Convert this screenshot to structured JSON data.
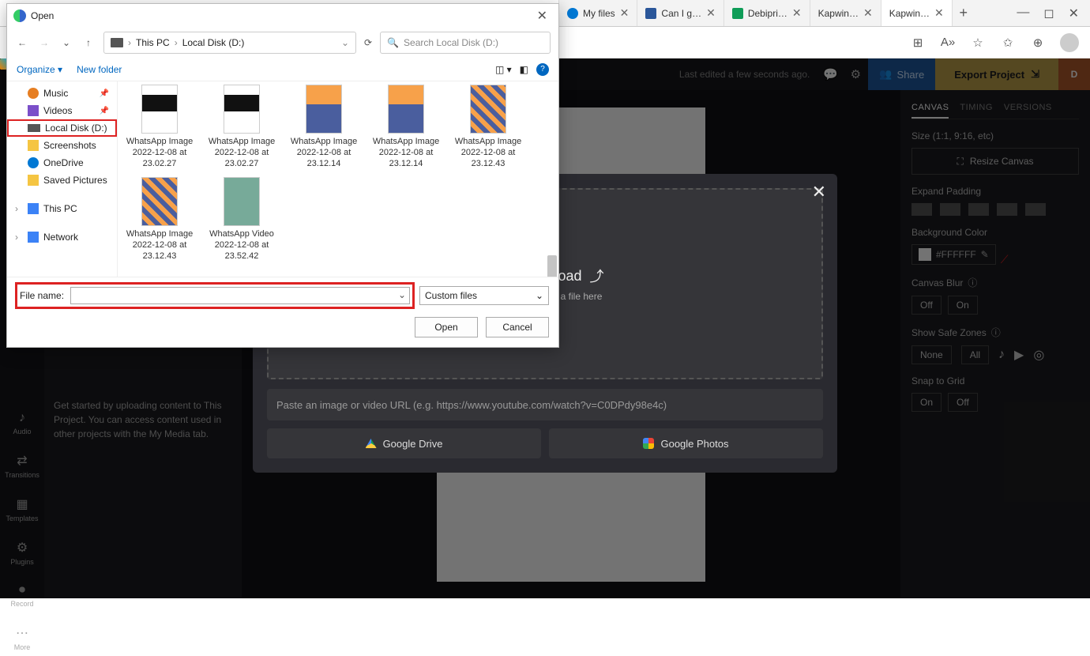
{
  "browser": {
    "tabs": [
      {
        "title": "Open",
        "closable": false,
        "icon": "edge"
      },
      {
        "title": "My files",
        "icon": "onedrive"
      },
      {
        "title": "Can I g…",
        "icon": "word"
      },
      {
        "title": "Debipri…",
        "icon": "sheets"
      },
      {
        "title": "Kapwin…",
        "icon": "kapwing"
      },
      {
        "title": "Kapwin…",
        "icon": "kapwing",
        "active": true
      }
    ],
    "toolbar_icons": [
      "apps",
      "read-aloud",
      "favorite",
      "collections",
      "extensions"
    ]
  },
  "kapwing": {
    "header": {
      "last_edited": "Last edited a few seconds ago.",
      "share": "Share",
      "export": "Export Project",
      "user_initial": "D"
    },
    "sidebar": [
      {
        "icon": "♪",
        "label": "Audio"
      },
      {
        "icon": "⇄",
        "label": "Transitions"
      },
      {
        "icon": "▦",
        "label": "Templates"
      },
      {
        "icon": "⚙",
        "label": "Plugins"
      },
      {
        "icon": "⏺",
        "label": "Record"
      },
      {
        "icon": "⋯",
        "label": "More"
      }
    ],
    "left_hint": "Get started by uploading content to This Project. You can access content used in other projects with the My Media tab.",
    "upload": {
      "title": "Click to Upload",
      "subtitle": "or drag and drop a file here",
      "url_placeholder": "Paste an image or video URL (e.g. https://www.youtube.com/watch?v=C0DPdy98e4c)",
      "gdrive": "Google Drive",
      "gphotos": "Google Photos"
    },
    "right": {
      "tabs": [
        "CANVAS",
        "TIMING",
        "VERSIONS"
      ],
      "active_tab": 0,
      "size_label": "Size (1:1, 9:16, etc)",
      "resize_btn": "Resize Canvas",
      "expand_label": "Expand Padding",
      "bg_label": "Background Color",
      "hex": "#FFFFFF",
      "swatches": [
        "#ffffff",
        "#666666",
        "#c0392b",
        "#d4a017",
        "#2e86c1"
      ],
      "blur_label": "Canvas Blur",
      "off": "Off",
      "on": "On",
      "safezone_label": "Show Safe Zones",
      "none": "None",
      "all": "All",
      "snap_label": "Snap to Grid"
    }
  },
  "file_dialog": {
    "title": "Open",
    "path": [
      "This PC",
      "Local Disk (D:)"
    ],
    "search_placeholder": "Search Local Disk (D:)",
    "organize": "Organize",
    "new_folder": "New folder",
    "tree": [
      {
        "label": "Music",
        "icon": "ico-music",
        "pinned": true
      },
      {
        "label": "Videos",
        "icon": "ico-videos",
        "pinned": true
      },
      {
        "label": "Local Disk (D:)",
        "icon": "ico-disk",
        "highlighted": true
      },
      {
        "label": "Screenshots",
        "icon": "ico-folder"
      },
      {
        "label": "OneDrive",
        "icon": "ico-one"
      },
      {
        "label": "Saved Pictures",
        "icon": "ico-folder"
      },
      {
        "label": "This PC",
        "icon": "ico-pc",
        "expandable": true
      },
      {
        "label": "Network",
        "icon": "ico-net",
        "expandable": true
      }
    ],
    "files": [
      {
        "name": "WhatsApp Image 2022-12-08 at 23.02.27",
        "thumb": "phone"
      },
      {
        "name": "WhatsApp Image 2022-12-08 at 23.02.27",
        "thumb": "phone"
      },
      {
        "name": "WhatsApp Image 2022-12-08 at 23.12.14",
        "thumb": "sunset"
      },
      {
        "name": "WhatsApp Image 2022-12-08 at 23.12.14",
        "thumb": "sunset"
      },
      {
        "name": "WhatsApp Image 2022-12-08 at 23.12.43",
        "thumb": "gallery"
      },
      {
        "name": "WhatsApp Image 2022-12-08 at 23.12.43",
        "thumb": "gallery"
      },
      {
        "name": "WhatsApp Video 2022-12-08 at 23.52.42",
        "thumb": "tree"
      }
    ],
    "file_name_label": "File name:",
    "file_type": "Custom files",
    "open": "Open",
    "cancel": "Cancel"
  }
}
